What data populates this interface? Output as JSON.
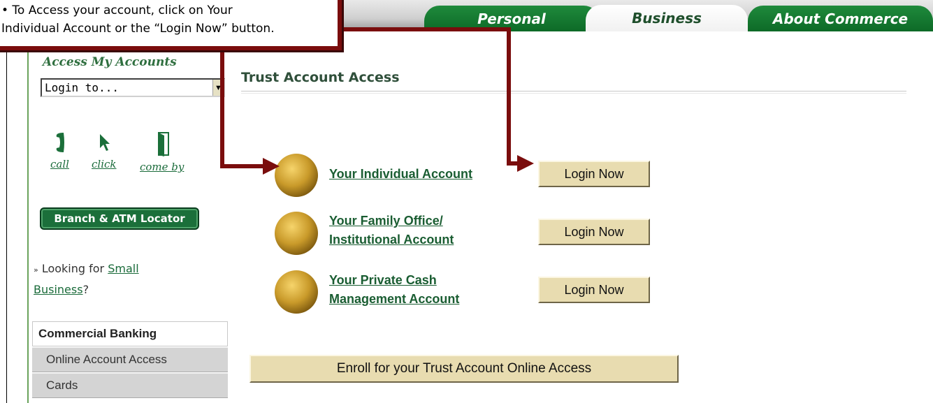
{
  "annotation": {
    "text": "• To Access your account, click on Your\nIndividual Account or the “Login Now” button."
  },
  "nav": {
    "tabs": [
      {
        "label": "Personal"
      },
      {
        "label": "Business"
      },
      {
        "label": "About Commerce"
      }
    ]
  },
  "sidebar": {
    "title": "Access My Accounts",
    "select_value": "Login to...",
    "contacts": [
      {
        "label": "call",
        "icon": "phone-icon"
      },
      {
        "label": "click",
        "icon": "cursor-icon"
      },
      {
        "label": "come by",
        "icon": "door-icon"
      }
    ],
    "atm_button": "Branch & ATM Locator",
    "small_business": {
      "prefix": "Looking for ",
      "link1": "Small",
      "link2": "Business",
      "suffix": "?"
    },
    "section_title": "Commercial Banking",
    "links": [
      "Online Account Access",
      "Cards"
    ]
  },
  "main": {
    "title": "Trust Account Access",
    "accounts": [
      {
        "line1": "Your Individual Account",
        "line2": "",
        "login": "Login Now"
      },
      {
        "line1": "Your Family Office/",
        "line2": "Institutional Account",
        "login": "Login Now"
      },
      {
        "line1": "Your Private Cash",
        "line2": "Management Account",
        "login": "Login Now"
      }
    ],
    "enroll": "Enroll for your Trust Account Online Access"
  },
  "colors": {
    "brand_green": "#1b6f3a",
    "annotation_red": "#7a0d0d",
    "button_tan": "#e8dcb0"
  }
}
